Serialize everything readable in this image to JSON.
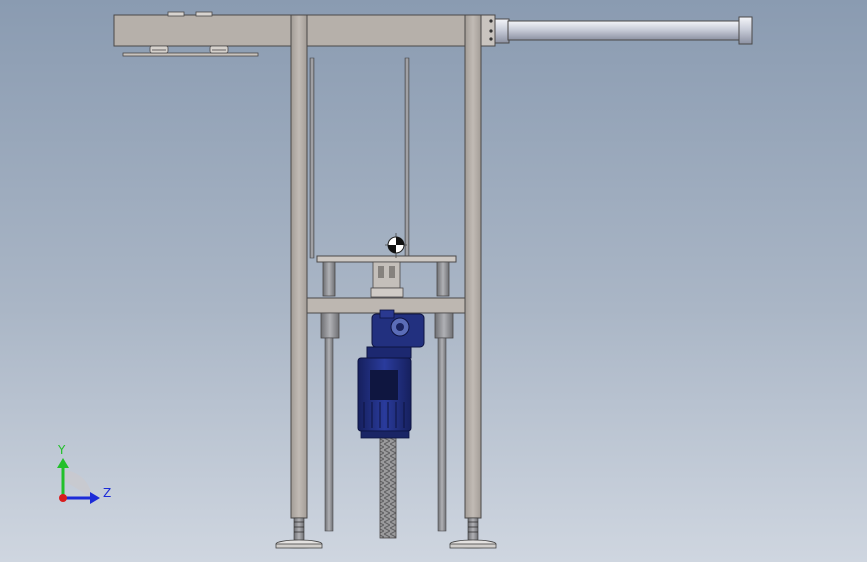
{
  "triad": {
    "y_label": "Y",
    "z_label": "Z",
    "y_color": "#22c02a",
    "z_color": "#1c2bd8",
    "x_color": "#d81c1c"
  },
  "model": {
    "frame_color": "#b3aca6",
    "rod_color": "#8d8e92",
    "motor_color": "#1e2c80",
    "cylinder_color": "#c5c9d6",
    "background_top": "#8a9bb1",
    "background_bottom": "#cfd6e0"
  }
}
